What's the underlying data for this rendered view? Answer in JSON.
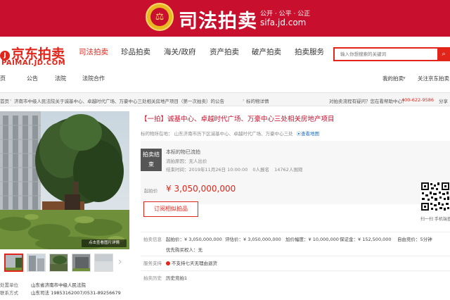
{
  "banner": {
    "title": "司法拍卖",
    "tagline": "公开 · 公平 · 公正",
    "url": "sifa.jd.com"
  },
  "logo": {
    "cn": "京东拍卖",
    "en": "PAIMAI.JD.COM"
  },
  "nav": {
    "items": [
      "司法拍卖",
      "珍品拍卖",
      "海关/政府",
      "资产拍卖",
      "破产拍卖",
      "拍卖服务"
    ],
    "active_index": 0
  },
  "search": {
    "placeholder": "输入你想搜索的关键词"
  },
  "subnav": {
    "items": [
      "公告",
      "法院",
      "法院合作"
    ],
    "right": [
      "我的拍卖",
      "关注京东拍卖"
    ]
  },
  "breadcrumb": {
    "home": "首页",
    "court": "济南市中级人民法院关于诚基中心、卓越时代广场、万豪中心三处相关房地产项目（第一次拍卖）的公告",
    "item": "标的物详情",
    "right_text": "对拍卖流程有疑问？您在看帮助中心？",
    "phone": "400-622-9586",
    "share": "分享"
  },
  "photo": {
    "enlarge_label": "点击查看图片详情"
  },
  "court": {
    "label": "处置单位",
    "name": "山东省济南市中级人民法院",
    "contact_label": "联系方式",
    "contact": "山东司法 19853162007/0531-89256679"
  },
  "item": {
    "title": "【一拍】诚基中心、卓越时代广场、万豪中心三处相关房地产项目",
    "location_label": "标的物所在地：",
    "location": "山东济南市历下区诚基中心、卓越时代广场、万豪中心三处",
    "map_link": "查看地图"
  },
  "status": {
    "badge": "拍卖结束",
    "line1": "本标的物已流拍",
    "line2": "流拍原因：无人出价",
    "line3": "结束时间：2019年11月26日 10:00:00",
    "line3_bids": "0人报名",
    "line3_views": "14762人围观",
    "price_label": "起拍价",
    "price": "¥ 3,050,000,000"
  },
  "subscribe": {
    "label": "订阅相似拍品"
  },
  "qr": {
    "caption": "扫一扫 手机端查看"
  },
  "info": {
    "row1_label": "拍卖信息",
    "start_price_label": "起拍价：",
    "start_price": "¥ 3,050,000,000",
    "eval_label": "评估价：",
    "eval_price": "¥ 3,050,000,000",
    "step_label": "加价幅度：",
    "step": "¥ 10,000,000",
    "deposit_label": "保证金：",
    "deposit": "¥ 152,500,000",
    "period_label": "自由竞价：",
    "period": "5分钟",
    "priority_label": "优先购买权人：",
    "priority": "无",
    "service_label": "服务支持",
    "service": "不支持七天无理由退货",
    "history_label": "拍卖历史",
    "history": "历史竞拍1"
  }
}
